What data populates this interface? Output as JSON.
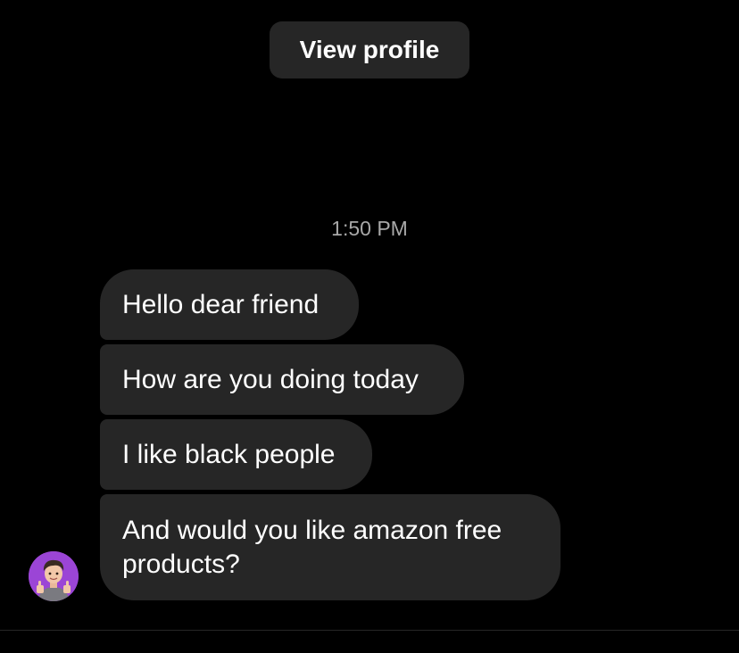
{
  "header": {
    "view_profile_label": "View profile"
  },
  "conversation": {
    "timestamp": "1:50 PM",
    "messages": [
      {
        "text": "Hello dear friend"
      },
      {
        "text": "How are you doing today"
      },
      {
        "text": "I like black people"
      },
      {
        "text": "And would you like amazon free products?"
      }
    ],
    "sender_avatar": {
      "icon": "memoji-thumbs-up-avatar"
    }
  },
  "colors": {
    "background": "#000000",
    "bubble": "#262626",
    "timestamp_text": "#a8a8a8",
    "text": "#ffffff",
    "avatar_bg": "#9b45d6"
  }
}
